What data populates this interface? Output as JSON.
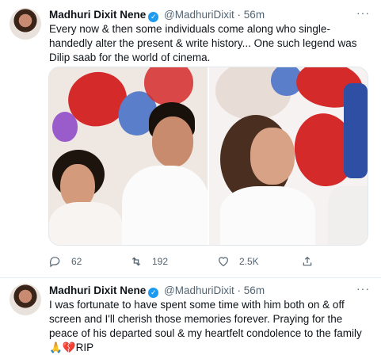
{
  "tweets": [
    {
      "author": "Madhuri Dixit Nene",
      "handle": "@MadhuriDixit",
      "separator": "·",
      "time": "56m",
      "text": "Every now & then some individuals come along who single-handedly alter the present & write history... One such legend was Dilip saab for the world of cinema.",
      "actions": {
        "reply_count": "62",
        "retweet_count": "192",
        "like_count": "2.5K"
      }
    },
    {
      "author": "Madhuri Dixit Nene",
      "handle": "@MadhuriDixit",
      "separator": "·",
      "time": "56m",
      "text": "I was fortunate to have spent some time with him both on & off screen and I'll cherish those memories forever. Praying for the peace of his departed soul & my heartfelt condolence to the family ",
      "emoji_text": "🙏💔",
      "suffix": "RIP"
    }
  ],
  "icons": [
    "verified-badge-icon",
    "more-icon",
    "reply-icon",
    "retweet-icon",
    "like-icon",
    "share-icon"
  ],
  "colors": {
    "accent": "#1d9bf0",
    "text": "#0f1419",
    "muted": "#536471",
    "divider": "#e6ecf0"
  }
}
